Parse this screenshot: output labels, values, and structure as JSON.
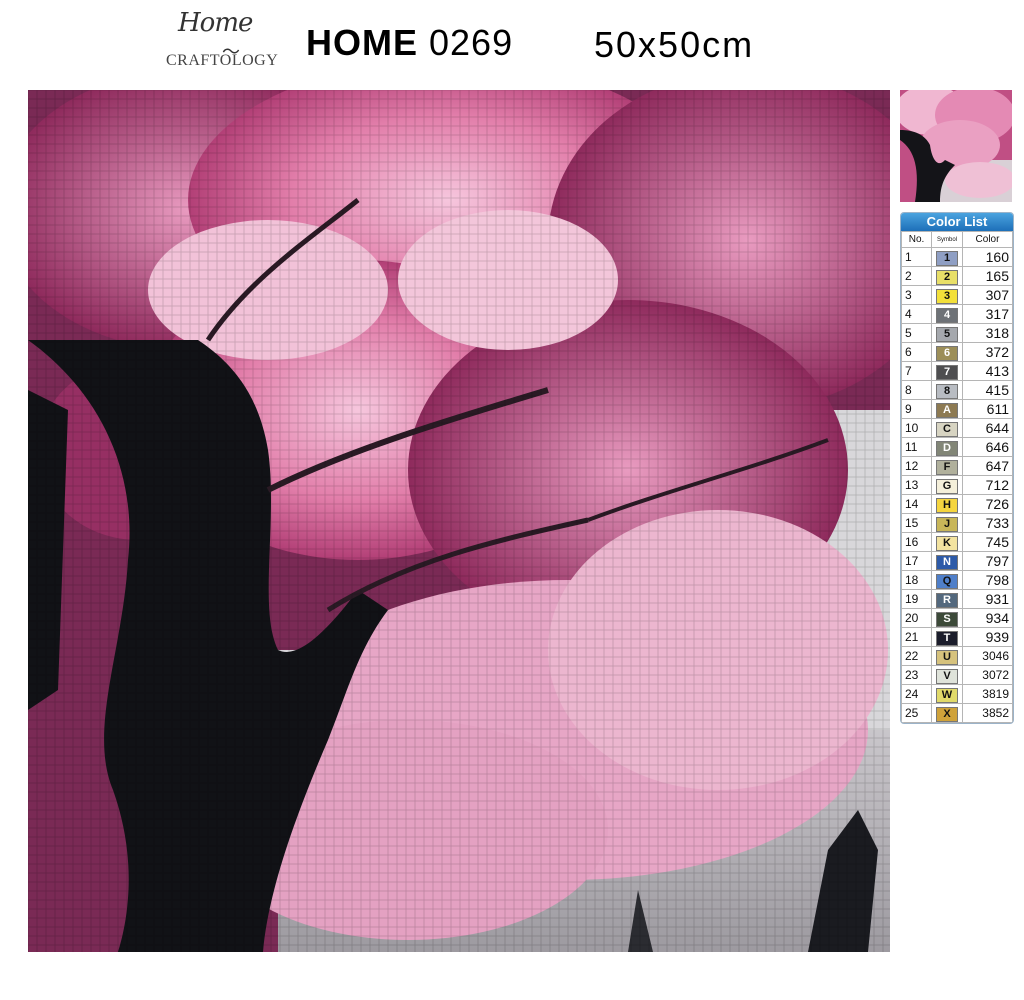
{
  "header": {
    "logo_script": "Home",
    "logo_sub": "CRAFTOLOGY",
    "code_prefix": "HOME",
    "code_number": "0269",
    "size": "50x50cm"
  },
  "colors": {
    "legend_header": "#1d6fb8",
    "blossom_pink": "#d9629a",
    "trunk": "#111216"
  },
  "legend": {
    "title": "Color List",
    "headers": [
      "No.",
      "Symbol",
      "Color"
    ],
    "rows": [
      {
        "no": "1",
        "symbol": "1",
        "color": "160",
        "swatch": "#8f9fc4"
      },
      {
        "no": "2",
        "symbol": "2",
        "color": "165",
        "swatch": "#e8df68"
      },
      {
        "no": "3",
        "symbol": "3",
        "color": "307",
        "swatch": "#f3e03a"
      },
      {
        "no": "4",
        "symbol": "4",
        "color": "317",
        "swatch": "#6e7277"
      },
      {
        "no": "5",
        "symbol": "5",
        "color": "318",
        "swatch": "#a5a8ad"
      },
      {
        "no": "6",
        "symbol": "6",
        "color": "372",
        "swatch": "#9c8e58"
      },
      {
        "no": "7",
        "symbol": "7",
        "color": "413",
        "swatch": "#4e4e50"
      },
      {
        "no": "8",
        "symbol": "8",
        "color": "415",
        "swatch": "#b8bcc2"
      },
      {
        "no": "9",
        "symbol": "A",
        "color": "611",
        "swatch": "#8d7a52"
      },
      {
        "no": "10",
        "symbol": "C",
        "color": "644",
        "swatch": "#d7d4c2"
      },
      {
        "no": "11",
        "symbol": "D",
        "color": "646",
        "swatch": "#828677"
      },
      {
        "no": "12",
        "symbol": "F",
        "color": "647",
        "swatch": "#b0b09c"
      },
      {
        "no": "13",
        "symbol": "G",
        "color": "712",
        "swatch": "#f4efda"
      },
      {
        "no": "14",
        "symbol": "H",
        "color": "726",
        "swatch": "#f5d53f"
      },
      {
        "no": "15",
        "symbol": "J",
        "color": "733",
        "swatch": "#c8b659"
      },
      {
        "no": "16",
        "symbol": "K",
        "color": "745",
        "swatch": "#f3e3a0"
      },
      {
        "no": "17",
        "symbol": "N",
        "color": "797",
        "swatch": "#2d5aa8"
      },
      {
        "no": "18",
        "symbol": "Q",
        "color": "798",
        "swatch": "#4f7fc9"
      },
      {
        "no": "19",
        "symbol": "R",
        "color": "931",
        "swatch": "#53687d"
      },
      {
        "no": "20",
        "symbol": "S",
        "color": "934",
        "swatch": "#3c4a39"
      },
      {
        "no": "21",
        "symbol": "T",
        "color": "939",
        "swatch": "#1b1d2b"
      },
      {
        "no": "22",
        "symbol": "U",
        "color": "3046",
        "swatch": "#d6c27d"
      },
      {
        "no": "23",
        "symbol": "V",
        "color": "3072",
        "swatch": "#dfe3da"
      },
      {
        "no": "24",
        "symbol": "W",
        "color": "3819",
        "swatch": "#e1da6a"
      },
      {
        "no": "25",
        "symbol": "X",
        "color": "3852",
        "swatch": "#cfa23a"
      }
    ]
  }
}
